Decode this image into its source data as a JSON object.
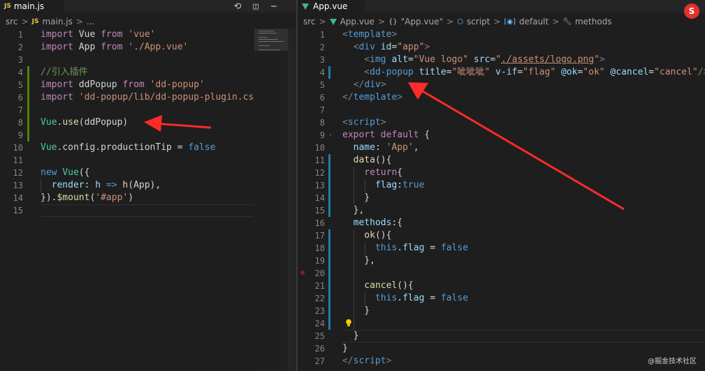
{
  "left": {
    "tab": {
      "label": "main.js",
      "icon": "js-icon",
      "icon_text": "JS"
    },
    "breadcrumb": {
      "src": "src",
      "icon_text": "JS",
      "file": "main.js",
      "ellipsis": "..."
    },
    "toolbar": {
      "compare_icon": "compare-icon",
      "split_icon": "split-editor-icon",
      "more_icon": "more-icon"
    },
    "line_numbers": [
      "1",
      "2",
      "3",
      "4",
      "5",
      "6",
      "7",
      "8",
      "9",
      "10",
      "11",
      "12",
      "13",
      "14",
      "15"
    ],
    "code": {
      "l1": {
        "a": "import",
        "b": " Vue ",
        "c": "from",
        "d": " 'vue'"
      },
      "l2": {
        "a": "import",
        "b": " App ",
        "c": "from",
        "d": " './App.vue'"
      },
      "l4": {
        "a": "//引入插件"
      },
      "l5": {
        "a": "import",
        "b": " ddPopup ",
        "c": "from",
        "d": " 'dd-popup'"
      },
      "l6": {
        "a": "import",
        "d": " 'dd-popup/lib/dd-popup-plugin.css'",
        "e": ";"
      },
      "l8": {
        "a": "Vue",
        "b": ".",
        "c": "use",
        "d": "(ddPopup)"
      },
      "l10": {
        "a": "Vue",
        "b": ".config.productionTip = ",
        "c": "false"
      },
      "l12": {
        "a": "new",
        "b": " Vue",
        "c": "({"
      },
      "l13": {
        "a": "  render",
        "b": ": ",
        "c": "h",
        "d": " => ",
        "e": "h",
        "f": "(App),"
      },
      "l14": {
        "a": "}).",
        "b": "$mount",
        "c": "(",
        "d": "'#app'",
        "e": ")"
      }
    }
  },
  "right": {
    "tab": {
      "label": "App.vue",
      "icon": "vue-icon",
      "close": "×"
    },
    "breadcrumb": {
      "src": "src",
      "file": "App.vue",
      "scope1": "\"App.vue\"",
      "scope2": "script",
      "scope3": "default",
      "scope4": "methods"
    },
    "line_numbers": [
      "1",
      "2",
      "3",
      "4",
      "5",
      "6",
      "7",
      "8",
      "9",
      "10",
      "11",
      "12",
      "13",
      "14",
      "15",
      "16",
      "17",
      "18",
      "19",
      "20",
      "21",
      "22",
      "23",
      "24",
      "25",
      "26",
      "27"
    ],
    "code": {
      "l1": {
        "a": "<",
        "b": "template",
        "c": ">"
      },
      "l2": {
        "a": "  <",
        "b": "div",
        "c": " id",
        "d": "=",
        "e": "\"app\"",
        "f": ">"
      },
      "l3": {
        "a": "    <",
        "b": "img",
        "c": " alt",
        "d": "=",
        "e": "\"Vue logo\"",
        "f": " src",
        "g": "=",
        "h": "\"",
        "i": "./assets/logo.png",
        "j": "\"",
        "k": ">"
      },
      "l4": {
        "a": "    <",
        "b": "dd-popup",
        "c": " title",
        "d": "=",
        "e": "\"呲呲呲\"",
        "f": " v-if",
        "g": "=",
        "h": "\"flag\"",
        "i": " @ok",
        "j": "=",
        "k": "\"ok\"",
        "l": " @cancel",
        "m": "=",
        "n": "\"cancel\"",
        "o": "/>"
      },
      "l5": {
        "a": "  </",
        "b": "div",
        "c": ">"
      },
      "l6": {
        "a": "</",
        "b": "template",
        "c": ">"
      },
      "l8": {
        "a": "<",
        "b": "script",
        "c": ">"
      },
      "l9": {
        "a": "export",
        "b": " ",
        "c": "default",
        "d": " {"
      },
      "l10": {
        "a": "  name",
        "b": ": ",
        "c": "'App'",
        "d": ","
      },
      "l11": {
        "a": "  data",
        "b": "(){"
      },
      "l12": {
        "a": "    return",
        "b": "{"
      },
      "l13": {
        "a": "      flag",
        "b": ":",
        "c": "true"
      },
      "l14": {
        "a": "    }"
      },
      "l15": {
        "a": "  },"
      },
      "l16": {
        "a": "  methods",
        "b": ":{"
      },
      "l17": {
        "a": "    ok",
        "b": "(){"
      },
      "l18": {
        "a": "      this",
        "b": ".",
        "c": "flag",
        "d": " = ",
        "e": "false"
      },
      "l19": {
        "a": "    },"
      },
      "l21": {
        "a": "    cancel",
        "b": "(){"
      },
      "l22": {
        "a": "      this",
        "b": ".",
        "c": "flag",
        "d": " = ",
        "e": "false"
      },
      "l23": {
        "a": "    }"
      },
      "l25": {
        "a": "  }"
      },
      "l26": {
        "a": "}"
      },
      "l27": {
        "a": "</",
        "b": "script",
        "c": ">"
      }
    }
  },
  "overlay": {
    "badge_text": "S",
    "watermark": "@掘金技术社区",
    "arrow_color": "#ff2a2a",
    "brand_color": "#e1322d"
  }
}
